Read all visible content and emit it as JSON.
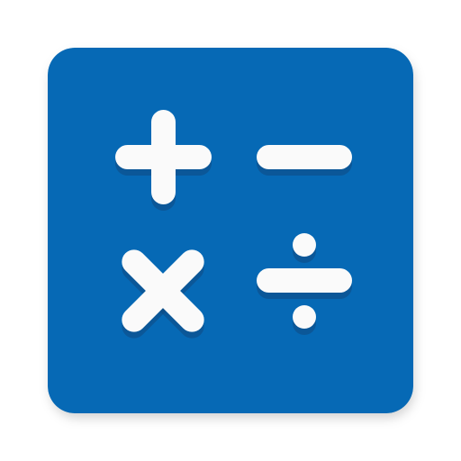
{
  "icon": {
    "name": "calculator-app-icon",
    "colors": {
      "tile": "#0669b5",
      "glyph": "#fafafa",
      "glyph_shadow": "#11497f"
    },
    "symbols": [
      "plus-icon",
      "minus-icon",
      "multiply-icon",
      "divide-icon"
    ]
  }
}
